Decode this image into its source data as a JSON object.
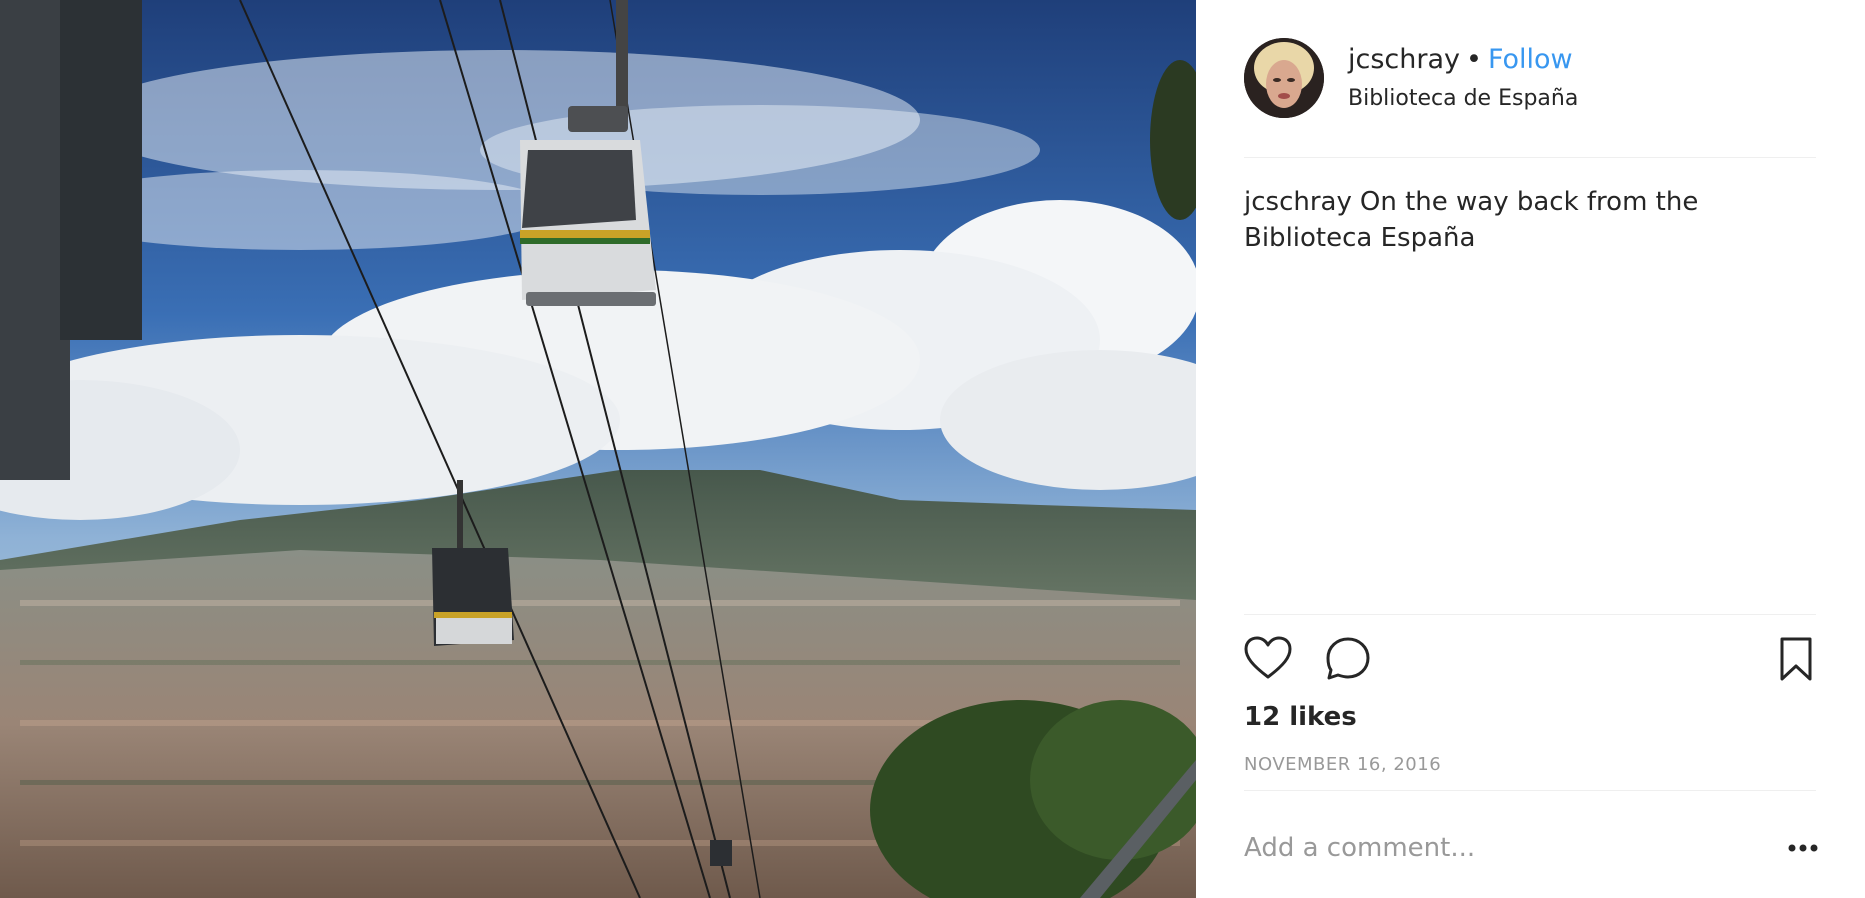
{
  "post": {
    "username": "jcschray",
    "separator": "•",
    "follow_label": "Follow",
    "location": "Biblioteca de España",
    "caption_user": "jcschray",
    "caption_text": "On the way back from the Biblioteca España",
    "likes_text": "12 likes",
    "date_text": "NOVEMBER 16, 2016"
  },
  "comment": {
    "placeholder": "Add a comment..."
  },
  "icons": {
    "like": "heart-icon",
    "comment": "speech-bubble-icon",
    "save": "bookmark-icon",
    "more": "ellipsis-icon"
  },
  "colors": {
    "follow_link": "#3897f0",
    "text": "#262626",
    "muted": "#999999",
    "divider": "#efefef"
  },
  "photo": {
    "alt": "Cable cars over a mountainside city under a cloudy blue sky"
  }
}
